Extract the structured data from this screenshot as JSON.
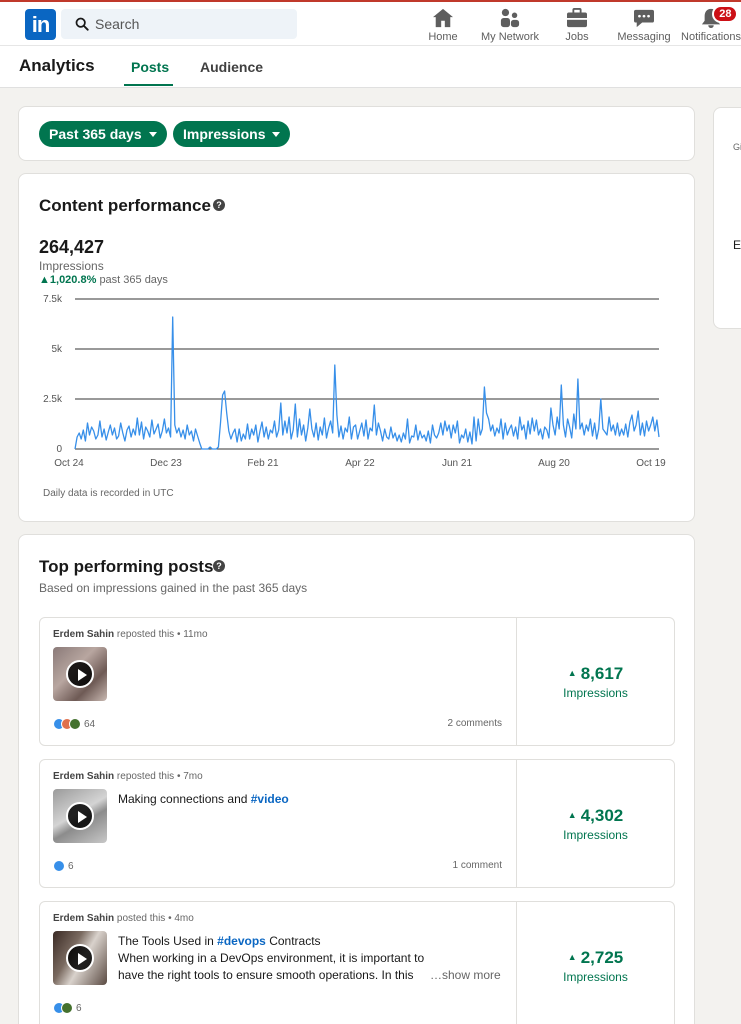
{
  "nav": {
    "logo": "in",
    "search_placeholder": "Search",
    "items": [
      {
        "label": "Home",
        "icon": "home-icon"
      },
      {
        "label": "My Network",
        "icon": "network-icon"
      },
      {
        "label": "Jobs",
        "icon": "briefcase-icon"
      },
      {
        "label": "Messaging",
        "icon": "messaging-icon"
      },
      {
        "label": "Notifications",
        "icon": "bell-icon",
        "badge": "28"
      }
    ]
  },
  "analytics": {
    "title": "Analytics",
    "tabs": [
      {
        "label": "Posts",
        "active": true
      },
      {
        "label": "Audience",
        "active": false
      }
    ]
  },
  "filters": {
    "period": "Past 365 days",
    "metric": "Impressions"
  },
  "performance": {
    "title": "Content performance",
    "total": "264,427",
    "metric_label": "Impressions",
    "change": "1,020.8%",
    "change_suffix": "past 365 days",
    "footnote": "Daily data is recorded in UTC"
  },
  "chart_data": {
    "type": "line",
    "series": [
      {
        "values": [
          0,
          600,
          800,
          500,
          950,
          400,
          1300,
          700,
          1100,
          900,
          500,
          700,
          1400,
          600,
          1000,
          450,
          850,
          1200,
          700,
          1050,
          500,
          650,
          1300,
          800,
          400,
          950,
          1150,
          600,
          1000,
          700,
          1550,
          700,
          1350,
          500,
          1100,
          900,
          600,
          1450,
          750,
          1000,
          1250,
          550,
          900,
          1500,
          800,
          1050,
          600,
          6600,
          1200,
          800,
          1050,
          600,
          950,
          500,
          1200,
          700,
          900,
          400,
          1000,
          650,
          300,
          0,
          0,
          0,
          0,
          100,
          0,
          0,
          0,
          100,
          1300,
          2700,
          2900,
          1800,
          900,
          500,
          800,
          1000,
          350,
          1000,
          400,
          750,
          500,
          1250,
          500,
          1000,
          700,
          1200,
          350,
          900,
          1350,
          600,
          1100,
          500,
          950,
          800,
          1400,
          600,
          950,
          2300,
          700,
          1400,
          800,
          1600,
          500,
          950,
          2250,
          600,
          1500,
          700,
          1200,
          400,
          1050,
          2000,
          1000,
          600,
          1300,
          450,
          1100,
          700,
          1550,
          550,
          1050,
          1400,
          800,
          4200,
          1700,
          600,
          1150,
          500,
          1050,
          850,
          1600,
          500,
          1100,
          1200,
          500,
          900,
          1300,
          650,
          1450,
          500,
          1050,
          900,
          2200,
          700,
          1300,
          900,
          400,
          1000,
          600,
          500,
          1100,
          550,
          800,
          400,
          700,
          350,
          800,
          500,
          1500,
          300,
          650,
          600,
          1200,
          450,
          900,
          550,
          700,
          400,
          900,
          300,
          1200,
          700,
          550,
          800,
          1300,
          700,
          1400,
          900,
          1200,
          550,
          1200,
          800,
          1400,
          300,
          700,
          550,
          1000,
          350,
          850,
          250,
          1600,
          400,
          1500,
          700,
          1000,
          3100,
          1800,
          1500,
          900,
          1200,
          650,
          1050,
          800,
          1500,
          500,
          1300,
          700,
          1000,
          1200,
          650,
          1100,
          500,
          1600,
          950,
          1200,
          500,
          1400,
          750,
          1550,
          900,
          1450,
          700,
          1000,
          500,
          1100,
          950,
          550,
          2050,
          1200,
          700,
          1600,
          1000,
          3200,
          1200,
          600,
          1500,
          1100,
          550,
          1750,
          1000,
          3500,
          1000,
          1300,
          700,
          1200,
          900,
          1500,
          650,
          1300,
          500,
          1000,
          2500,
          1000,
          850,
          700,
          1600,
          900,
          1200,
          700,
          1300,
          650,
          1000,
          700,
          1250,
          600,
          1350,
          1700,
          900,
          1200,
          1900,
          700,
          1300,
          650,
          1400,
          900,
          1200,
          1600,
          900,
          1450,
          600
        ]
      }
    ],
    "xtick_labels": [
      "Oct 24",
      "Dec 23",
      "Feb 21",
      "Apr 22",
      "Jun 21",
      "Aug 20",
      "Oct 19"
    ],
    "ytick_labels": [
      "0",
      "2.5k",
      "5k",
      "7.5k"
    ],
    "ylim": [
      0,
      7500
    ]
  },
  "top_posts": {
    "title": "Top performing posts",
    "subtitle": "Based on impressions gained in the past 365 days",
    "impressions_label": "Impressions",
    "posts": [
      {
        "author": "Erdem Sahin",
        "action": "reposted this • 11mo",
        "text": "",
        "tag": "",
        "reactions": "64",
        "comments": "2 comments",
        "impressions": "8,617"
      },
      {
        "author": "Erdem Sahin",
        "action": "reposted this • 7mo",
        "text": "Making connections and ",
        "tag": "#video",
        "reactions": "6",
        "comments": "1 comment",
        "impressions": "4,302"
      },
      {
        "author": "Erdem Sahin",
        "action": "posted this • 4mo",
        "text": "The Tools Used in ",
        "tag": "#devops",
        "text_after": " Contracts",
        "body": "When working in a DevOps environment, it is important to have the right tools to ensure smooth operations. In this article, we",
        "more": "…show more",
        "reactions": "6",
        "comments": "",
        "impressions": "2,725"
      }
    ]
  },
  "side": {
    "t1": "Gi",
    "t2": "Er"
  }
}
